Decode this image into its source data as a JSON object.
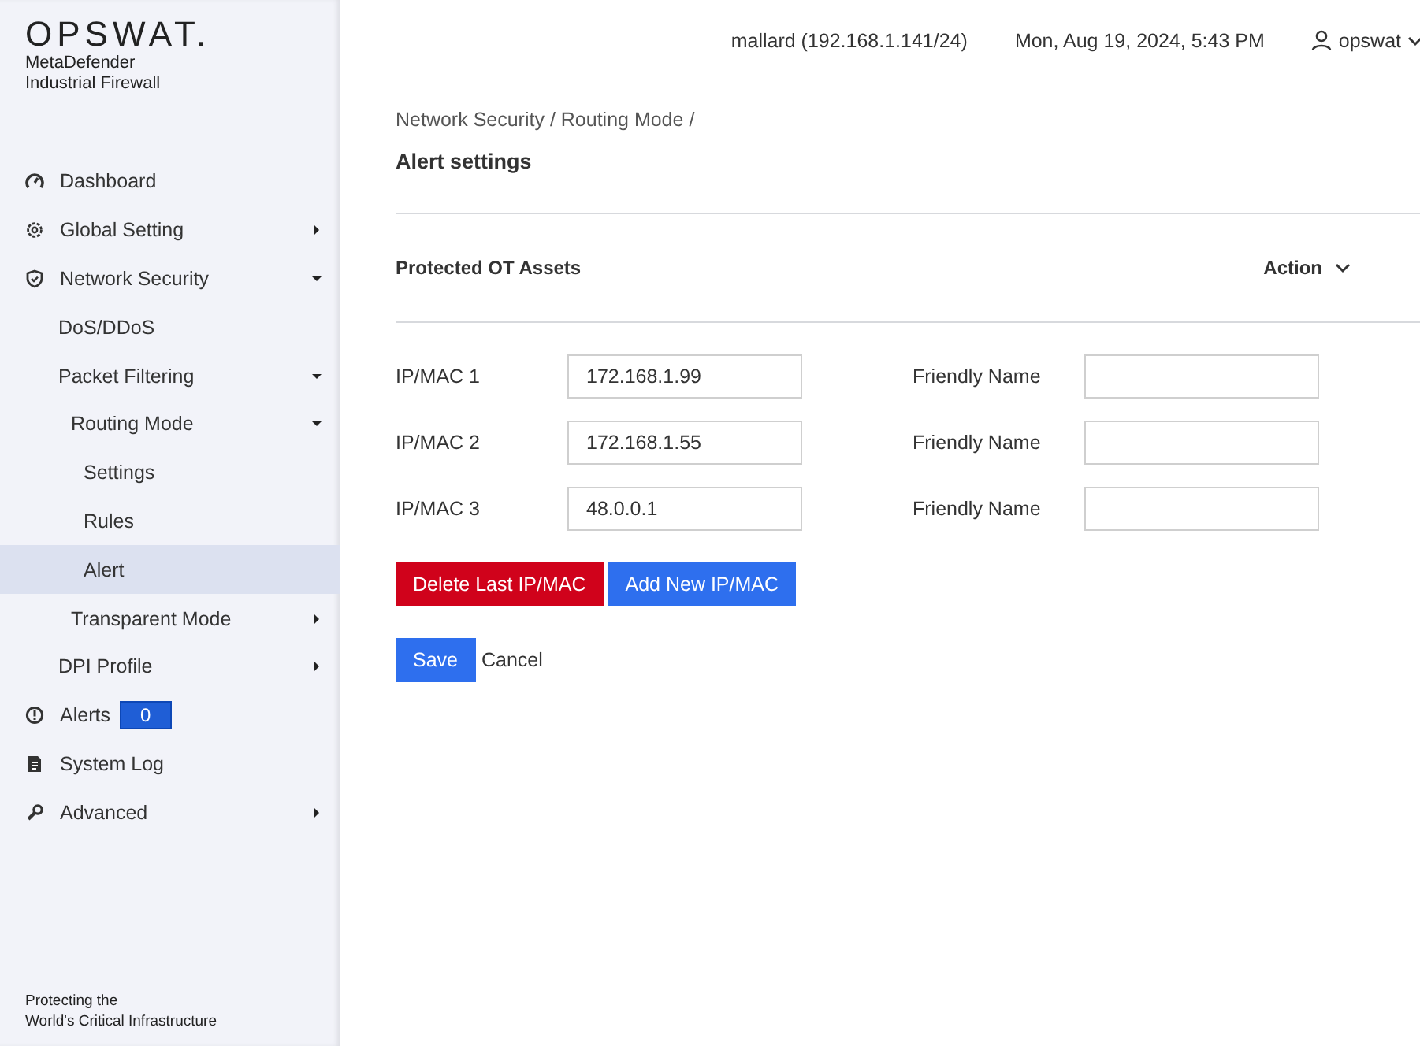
{
  "brand": {
    "logo": "OPSWAT.",
    "product_line1": "MetaDefender",
    "product_line2": "Industrial Firewall",
    "tagline_line1": "Protecting the",
    "tagline_line2": "World's Critical Infrastructure"
  },
  "sidebar": {
    "items": [
      {
        "label": "Dashboard",
        "selected": false
      },
      {
        "label": "Global Setting",
        "selected": false,
        "expanded": false
      },
      {
        "label": "Network Security",
        "selected": false,
        "expanded": true,
        "children": [
          {
            "label": "DoS/DDoS",
            "selected": false
          },
          {
            "label": "Packet Filtering",
            "selected": false,
            "expanded": true,
            "children": [
              {
                "label": "Routing Mode",
                "selected": false,
                "expanded": true,
                "children": [
                  {
                    "label": "Settings",
                    "selected": false
                  },
                  {
                    "label": "Rules",
                    "selected": false
                  },
                  {
                    "label": "Alert",
                    "selected": true
                  }
                ]
              },
              {
                "label": "Transparent Mode",
                "selected": false,
                "expanded": false
              }
            ]
          },
          {
            "label": "DPI Profile",
            "selected": false,
            "expanded": false
          }
        ]
      },
      {
        "label": "Alerts",
        "selected": false,
        "badge": "0"
      },
      {
        "label": "System Log",
        "selected": false
      },
      {
        "label": "Advanced",
        "selected": false,
        "expanded": false
      }
    ]
  },
  "header": {
    "device": "mallard (192.168.1.141/24)",
    "datetime": "Mon, Aug 19, 2024, 5:43 PM",
    "user": "opswat"
  },
  "breadcrumb": "Network Security / Routing Mode /",
  "page_title": "Alert settings",
  "section": {
    "title": "Protected OT Assets",
    "action": "Action"
  },
  "assets": [
    {
      "label": "IP/MAC 1",
      "value": "172.168.1.99",
      "name_label": "Friendly Name"
    },
    {
      "label": "IP/MAC 2",
      "value": "172.168.1.55",
      "name_label": "Friendly Name"
    },
    {
      "label": "IP/MAC 3",
      "value": "48.0.0.1",
      "name_label": "Friendly Name"
    }
  ],
  "buttons": {
    "delete": "Delete Last IP/MAC",
    "add": "Add New IP/MAC",
    "save": "Save",
    "cancel": "Cancel"
  }
}
